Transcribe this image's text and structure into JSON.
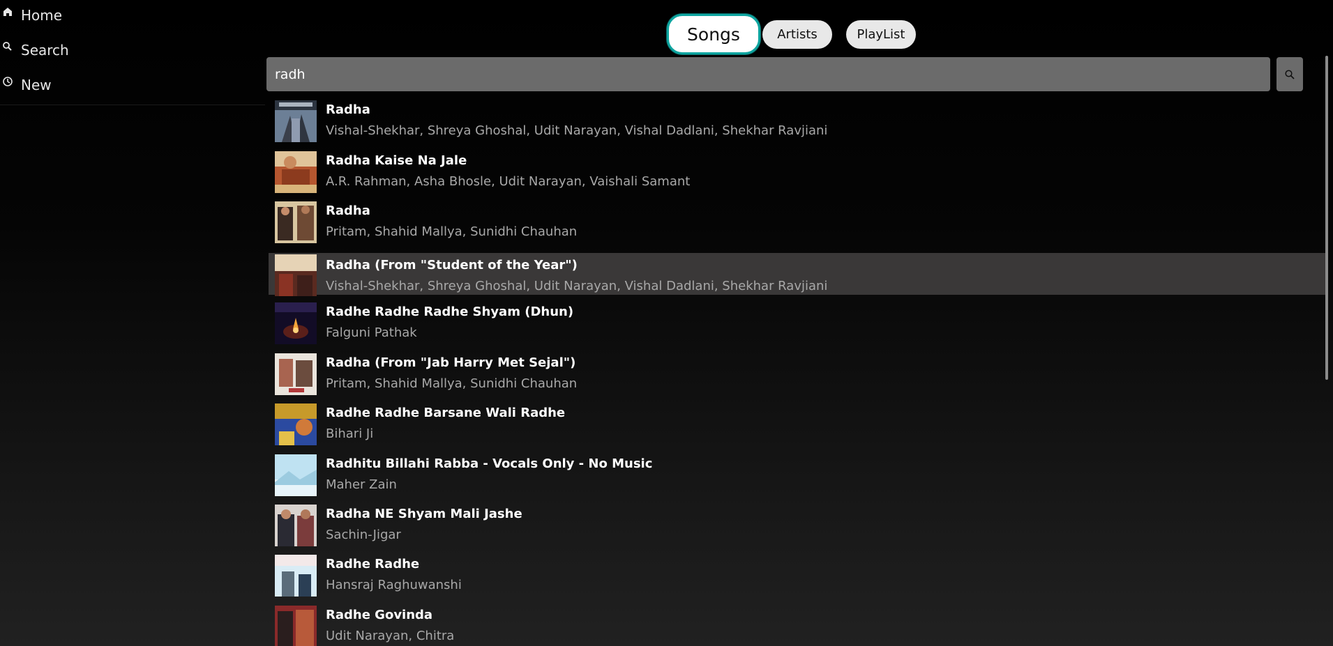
{
  "sidebar": {
    "items": [
      {
        "label": "Home",
        "icon": "home-icon"
      },
      {
        "label": "Search",
        "icon": "search-icon"
      },
      {
        "label": "New",
        "icon": "clock-icon"
      }
    ]
  },
  "tabs": [
    {
      "label": "Songs",
      "active": true
    },
    {
      "label": "Artists",
      "active": false
    },
    {
      "label": "PlayList",
      "active": false
    }
  ],
  "search": {
    "value": "radh",
    "button_icon": "search-icon"
  },
  "colors": {
    "accent": "#0ea5a0",
    "selected_row": "#3a3838",
    "input_bg": "#6b6b6b",
    "secondary_text": "#a8a8a8"
  },
  "results": [
    {
      "title": "Radha",
      "artists": "Vishal-Shekhar, Shreya Ghoshal, Udit Narayan, Vishal Dadlani, Shekhar Ravjiani",
      "selected": false
    },
    {
      "title": "Radha Kaise Na Jale",
      "artists": "A.R. Rahman, Asha Bhosle, Udit Narayan, Vaishali Samant",
      "selected": false
    },
    {
      "title": "Radha",
      "artists": "Pritam, Shahid Mallya, Sunidhi Chauhan",
      "selected": false
    },
    {
      "title": "Radha (From \"Student of the Year\")",
      "artists": "Vishal-Shekhar, Shreya Ghoshal, Udit Narayan, Vishal Dadlani, Shekhar Ravjiani",
      "selected": true
    },
    {
      "title": "Radhe Radhe Radhe Shyam (Dhun)",
      "artists": "Falguni Pathak",
      "selected": false
    },
    {
      "title": "Radha (From \"Jab Harry Met Sejal\")",
      "artists": "Pritam, Shahid Mallya, Sunidhi Chauhan",
      "selected": false
    },
    {
      "title": "Radhe Radhe Barsane Wali Radhe",
      "artists": "Bihari Ji",
      "selected": false
    },
    {
      "title": "Radhitu Billahi Rabba - Vocals Only - No Music",
      "artists": "Maher Zain",
      "selected": false
    },
    {
      "title": "Radha NE Shyam Mali Jashe",
      "artists": "Sachin-Jigar",
      "selected": false
    },
    {
      "title": "Radhe Radhe",
      "artists": "Hansraj Raghuwanshi",
      "selected": false
    },
    {
      "title": "Radhe Govinda",
      "artists": "Udit Narayan, Chitra",
      "selected": false
    }
  ]
}
